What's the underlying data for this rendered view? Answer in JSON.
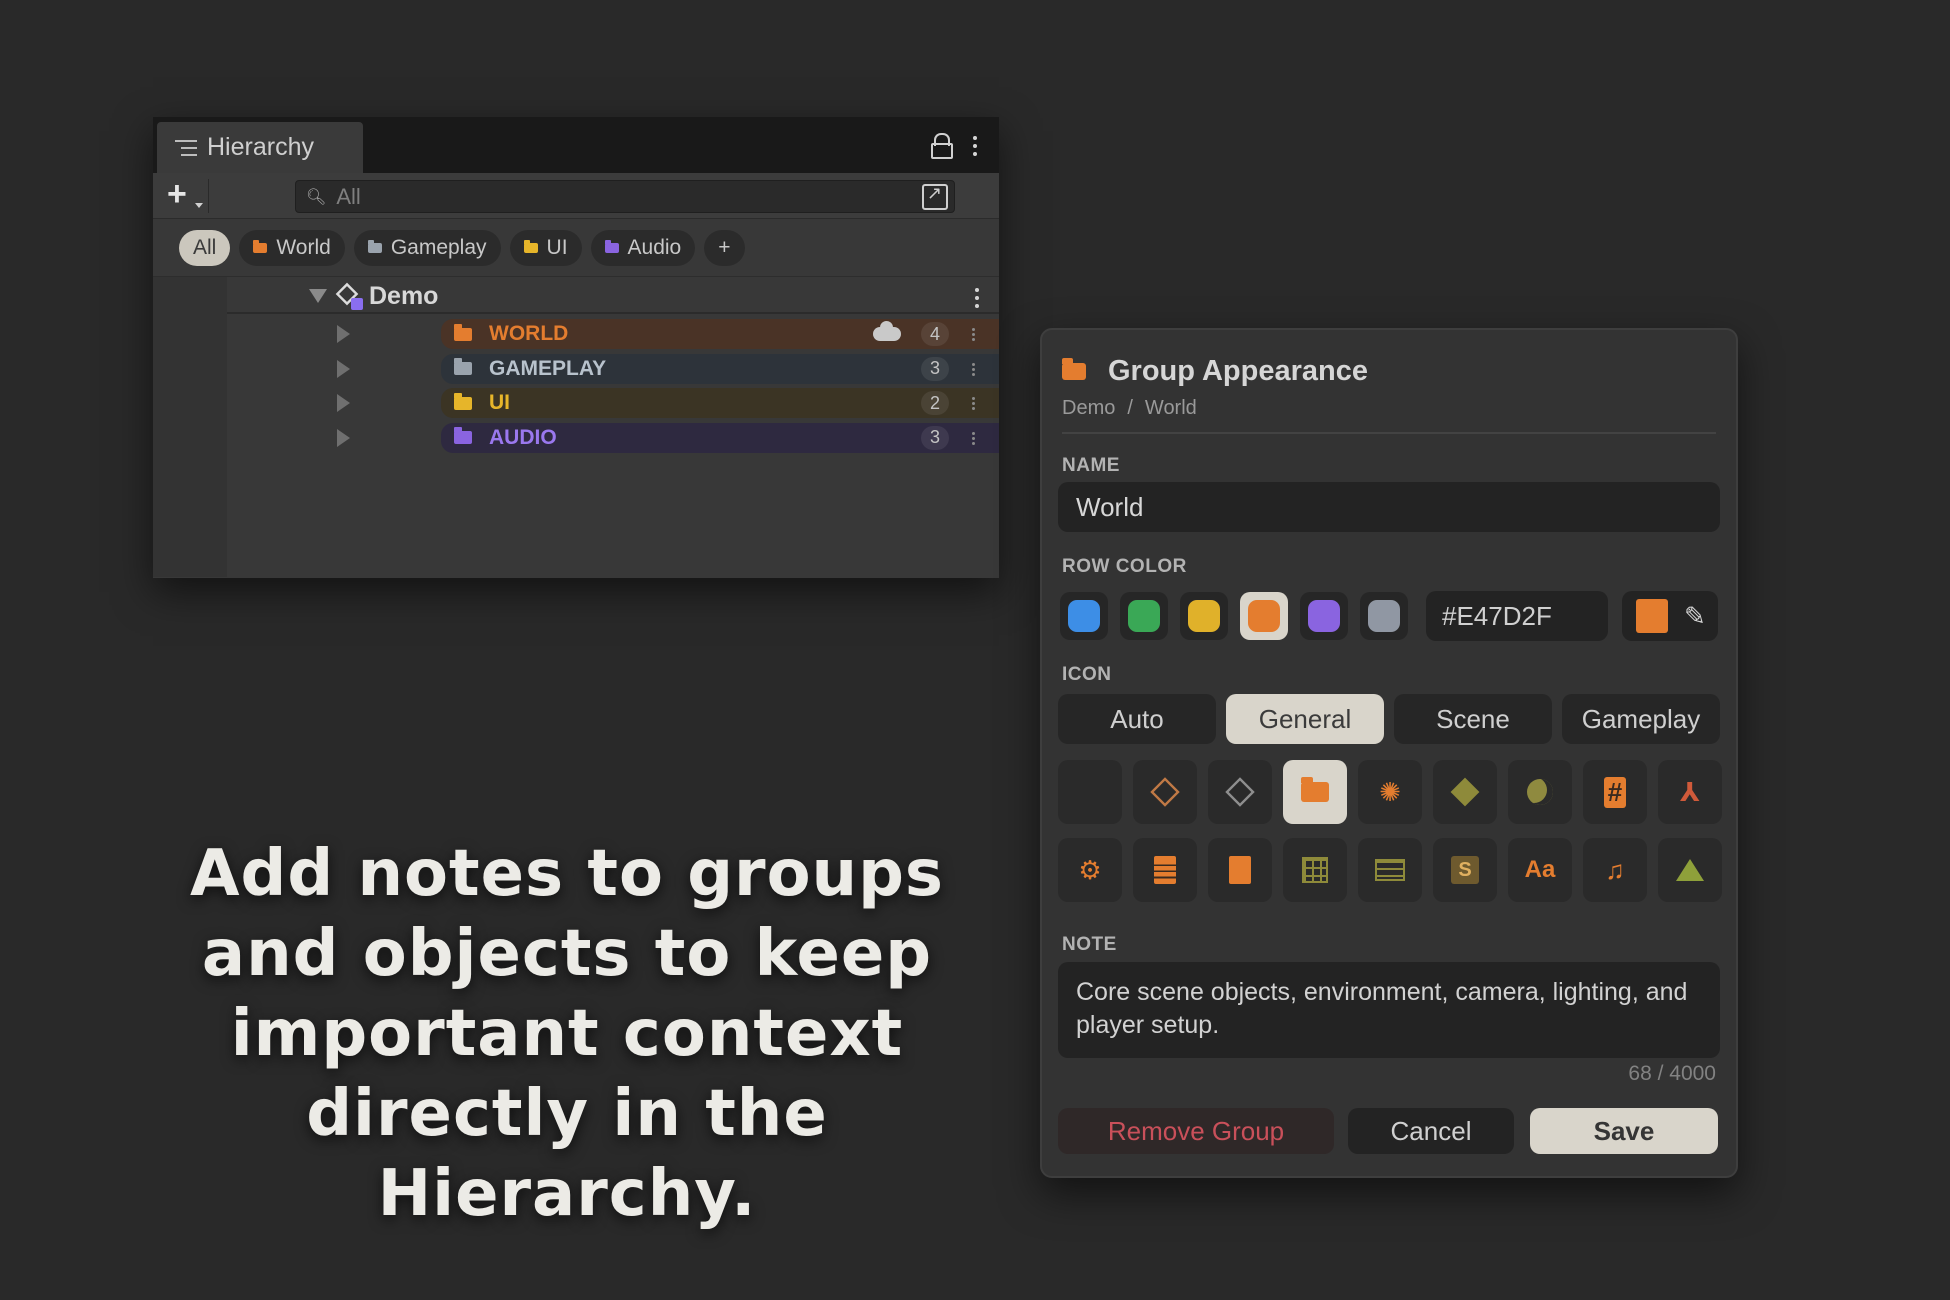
{
  "hierarchy": {
    "tab_title": "Hierarchy",
    "search_placeholder": "All",
    "chips": [
      {
        "label": "All",
        "color": ""
      },
      {
        "label": "World",
        "color": "#e47d2f"
      },
      {
        "label": "Gameplay",
        "color": "#9aa3ad"
      },
      {
        "label": "UI",
        "color": "#e6b52a"
      },
      {
        "label": "Audio",
        "color": "#8a64e0"
      },
      {
        "label": "+",
        "color": ""
      }
    ],
    "scene_name": "Demo",
    "groups": [
      {
        "name": "WORLD",
        "count": "4",
        "text_color": "#e47d2f",
        "bar_color": "#4a3326",
        "folder_color": "#e47d2f"
      },
      {
        "name": "GAMEPLAY",
        "count": "3",
        "text_color": "#b8c2cc",
        "bar_color": "#2d333a",
        "folder_color": "#9aa3ad"
      },
      {
        "name": "UI",
        "count": "2",
        "text_color": "#e6b52a",
        "bar_color": "#3b3424",
        "folder_color": "#e6b52a"
      },
      {
        "name": "AUDIO",
        "count": "3",
        "text_color": "#9a78ee",
        "bar_color": "#2e2940",
        "folder_color": "#8a64e0"
      }
    ]
  },
  "caption": "Add notes to groups and objects to keep important context directly in the Hierarchy.",
  "panel": {
    "title": "Group Appearance",
    "breadcrumb": [
      "Demo",
      "/",
      "World"
    ],
    "name_label": "NAME",
    "name_value": "World",
    "row_color_label": "ROW COLOR",
    "swatches": [
      "#3d8ee6",
      "#3aa856",
      "#e0b12a",
      "#e47d2f",
      "#8a64e0",
      "#9097a3"
    ],
    "selected_swatch": 3,
    "hex_value": "#E47D2F",
    "icon_label": "ICON",
    "icon_tabs": [
      "Auto",
      "General",
      "Scene",
      "Gameplay"
    ],
    "active_icon_tab": 1,
    "icons": [
      "empty-icon",
      "cube-icon",
      "cube-outline-icon",
      "folder-icon",
      "unity-icon",
      "box-icon",
      "moon-icon",
      "hash-icon",
      "axes-icon",
      "gear-icon",
      "document-lines-icon",
      "document-icon",
      "grid-icon",
      "brick-icon",
      "script-icon",
      "text-icon",
      "music-icon",
      "terrain-icon"
    ],
    "note_label": "NOTE",
    "note_value": "Core scene objects, environment, camera, lighting, and player setup.",
    "note_counter": "68 / 4000",
    "remove_label": "Remove Group",
    "cancel_label": "Cancel",
    "save_label": "Save",
    "accent_color": "#e47d2f"
  }
}
